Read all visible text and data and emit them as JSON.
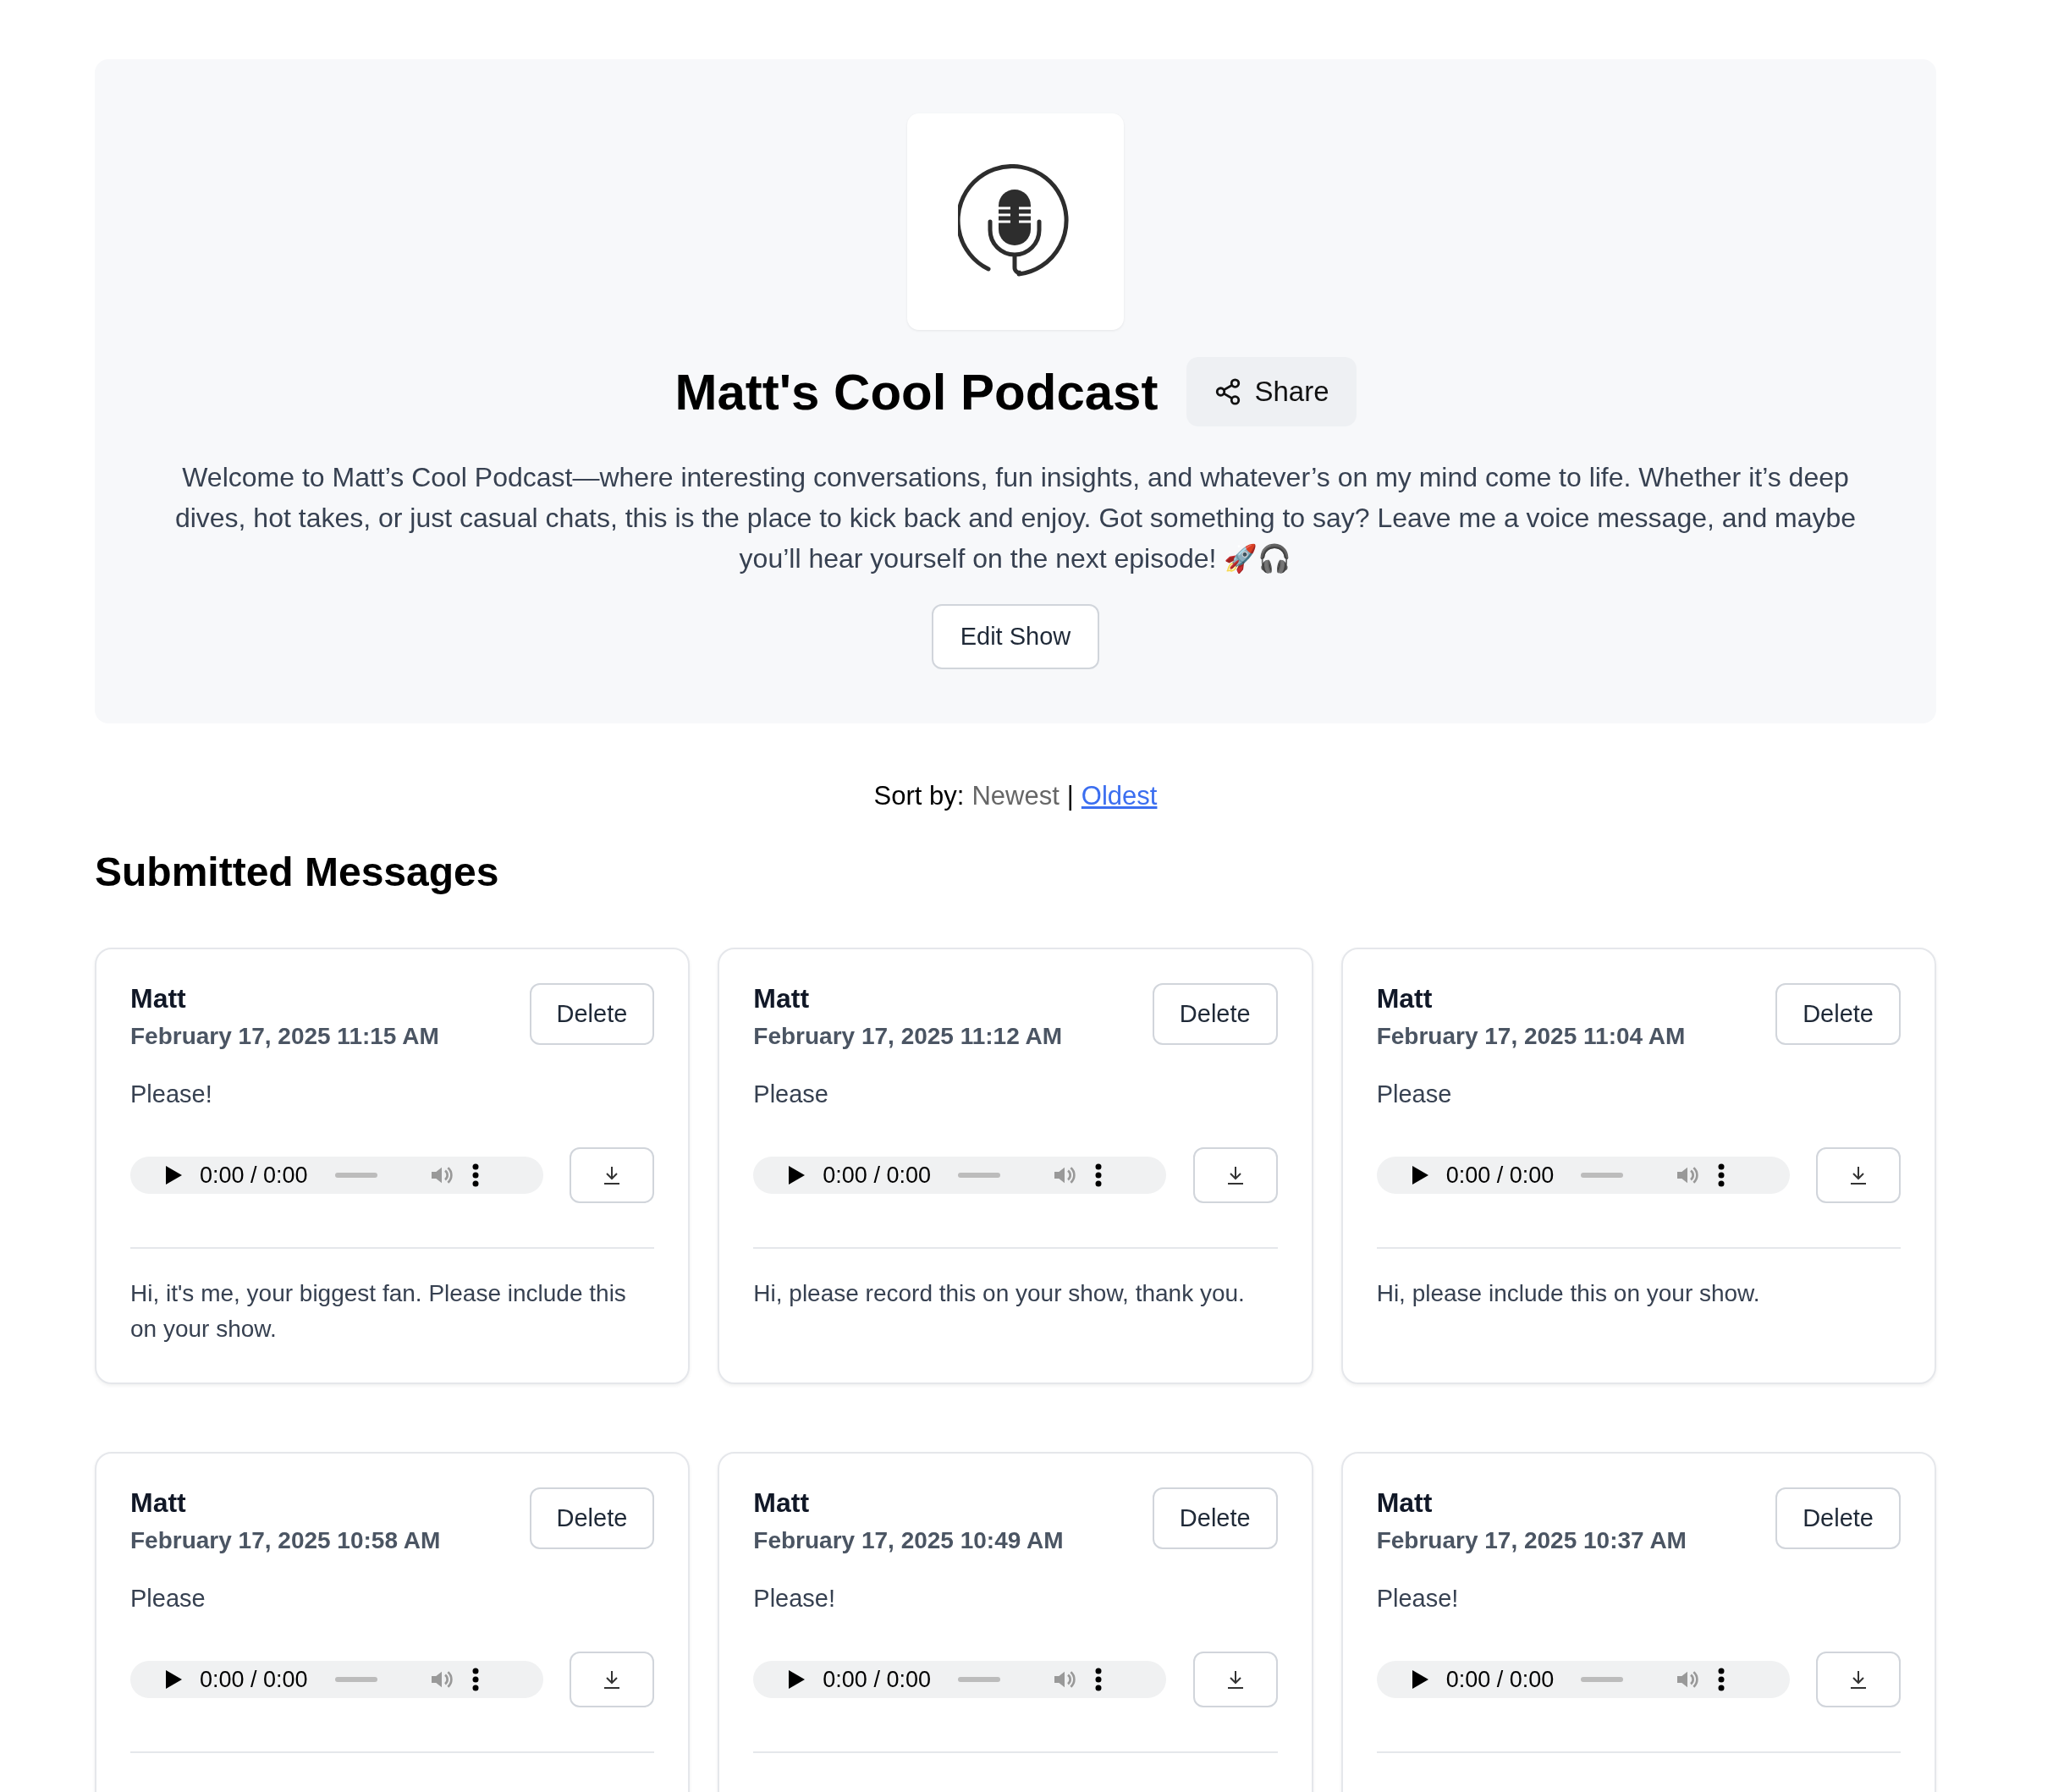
{
  "show": {
    "title": "Matt's Cool Podcast",
    "share_label": "Share",
    "description": "Welcome to Matt’s Cool Podcast—where interesting conversations, fun insights, and whatever’s on my mind come to life. Whether it’s deep dives, hot takes, or just casual chats, this is the place to kick back and enjoy. Got something to say? Leave me a voice message, and maybe you’ll hear yourself on the next episode! 🚀🎧",
    "edit_label": "Edit Show"
  },
  "sort": {
    "label": "Sort by:",
    "separator": "|",
    "options": [
      {
        "label": "Newest",
        "selected": true
      },
      {
        "label": "Oldest",
        "selected": false
      }
    ]
  },
  "section_title": "Submitted Messages",
  "messages": [
    {
      "name": "Matt",
      "date": "February 17, 2025 11:15 AM",
      "delete_label": "Delete",
      "title": "Please!",
      "time": "0:00 / 0:00",
      "transcript": "Hi, it's me, your biggest fan. Please include this on your show."
    },
    {
      "name": "Matt",
      "date": "February 17, 2025 11:12 AM",
      "delete_label": "Delete",
      "title": "Please",
      "time": "0:00 / 0:00",
      "transcript": "Hi, please record this on your show, thank you."
    },
    {
      "name": "Matt",
      "date": "February 17, 2025 11:04 AM",
      "delete_label": "Delete",
      "title": "Please",
      "time": "0:00 / 0:00",
      "transcript": "Hi, please include this on your show."
    },
    {
      "name": "Matt",
      "date": "February 17, 2025 10:58 AM",
      "delete_label": "Delete",
      "title": "Please",
      "time": "0:00 / 0:00"
    },
    {
      "name": "Matt",
      "date": "February 17, 2025 10:49 AM",
      "delete_label": "Delete",
      "title": "Please!",
      "time": "0:00 / 0:00"
    },
    {
      "name": "Matt",
      "date": "February 17, 2025 10:37 AM",
      "delete_label": "Delete",
      "title": "Please!",
      "time": "0:00 / 0:00"
    }
  ]
}
